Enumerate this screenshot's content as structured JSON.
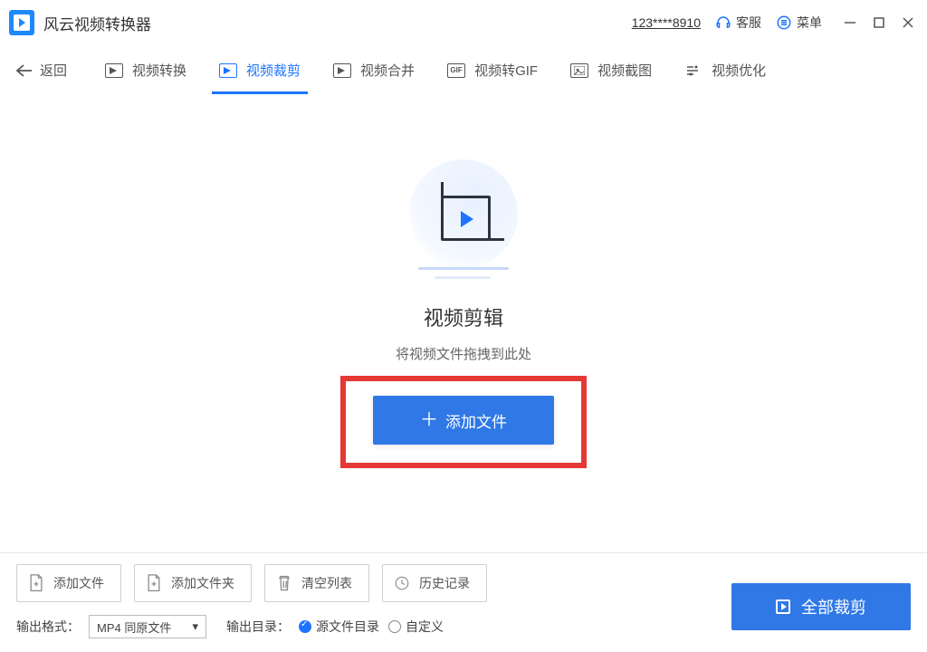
{
  "app": {
    "title": "风云视频转换器"
  },
  "titlebar": {
    "user_id": "123****8910",
    "support_label": "客服",
    "menu_label": "菜单"
  },
  "back_label": "返回",
  "tabs": [
    {
      "id": "convert",
      "label": "视频转换"
    },
    {
      "id": "crop",
      "label": "视频裁剪",
      "active": true
    },
    {
      "id": "merge",
      "label": "视频合并"
    },
    {
      "id": "gif",
      "label": "视频转GIF"
    },
    {
      "id": "snapshot",
      "label": "视频截图"
    },
    {
      "id": "optimize",
      "label": "视频优化"
    }
  ],
  "empty": {
    "title": "视频剪辑",
    "subtitle": "将视频文件拖拽到此处",
    "add_button": "添加文件"
  },
  "bottom": {
    "add_file": "添加文件",
    "add_folder": "添加文件夹",
    "clear_list": "清空列表",
    "history": "历史记录",
    "output_format_label": "输出格式：",
    "output_format_value": "MP4 同原文件",
    "output_dir_label": "输出目录：",
    "dir_source": "源文件目录",
    "dir_custom": "自定义",
    "run_button": "全部裁剪"
  }
}
